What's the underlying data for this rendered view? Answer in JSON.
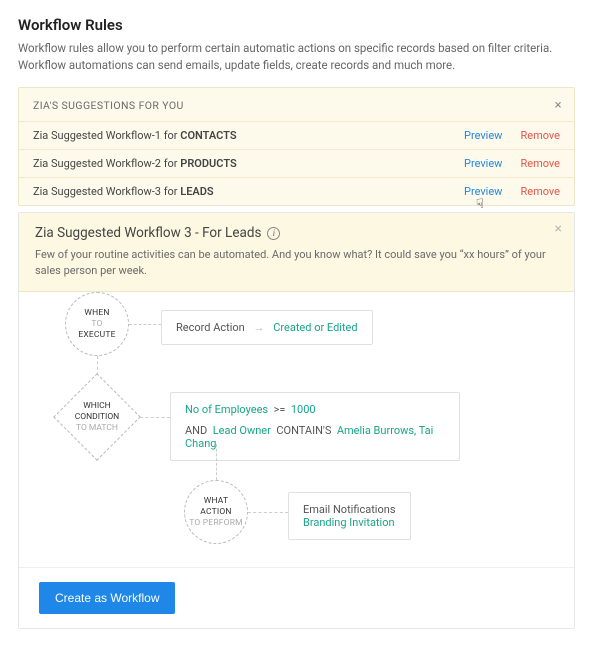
{
  "header": {
    "title": "Workflow Rules",
    "description": "Workflow rules allow you to perform certain automatic actions on specific records based on filter criteria. Workflow automations can send emails, update fields, create records and much more."
  },
  "suggestions": {
    "heading": "ZIA'S SUGGESTIONS FOR YOU",
    "rows": [
      {
        "prefix": "Zia Suggested Workflow-1 for ",
        "module": "CONTACTS",
        "preview": "Preview",
        "remove": "Remove"
      },
      {
        "prefix": "Zia Suggested Workflow-2 for ",
        "module": "PRODUCTS",
        "preview": "Preview",
        "remove": "Remove"
      },
      {
        "prefix": "Zia Suggested Workflow-3 for ",
        "module": "LEADS",
        "preview": "Preview",
        "remove": "Remove"
      }
    ]
  },
  "detail": {
    "title": "Zia Suggested Workflow 3 - For Leads",
    "subtitle": "Few of your routine activities can be automated. And you know what? It could save you “xx hours” of your sales person per week.",
    "nodes": {
      "when": {
        "l1": "WHEN",
        "l2": "TO",
        "l3": "EXECUTE"
      },
      "which": {
        "l1": "WHICH",
        "l2": "CONDITION",
        "l3": "TO MATCH"
      },
      "what": {
        "l1": "WHAT",
        "l2": "ACTION",
        "l3": "TO PERFORM"
      }
    },
    "when_card": {
      "label": "Record Action",
      "value": "Created or Edited"
    },
    "condition_card": {
      "field1": "No of Employees",
      "op1": ">=",
      "val1": "1000",
      "conj": "AND",
      "field2": "Lead Owner",
      "op2": "CONTAIN'S",
      "val2": "Amelia Burrows, Tai Chang"
    },
    "action_card": {
      "type": "Email Notifications",
      "template": "Branding Invitation"
    }
  },
  "footer": {
    "create_btn": "Create as Workflow"
  }
}
